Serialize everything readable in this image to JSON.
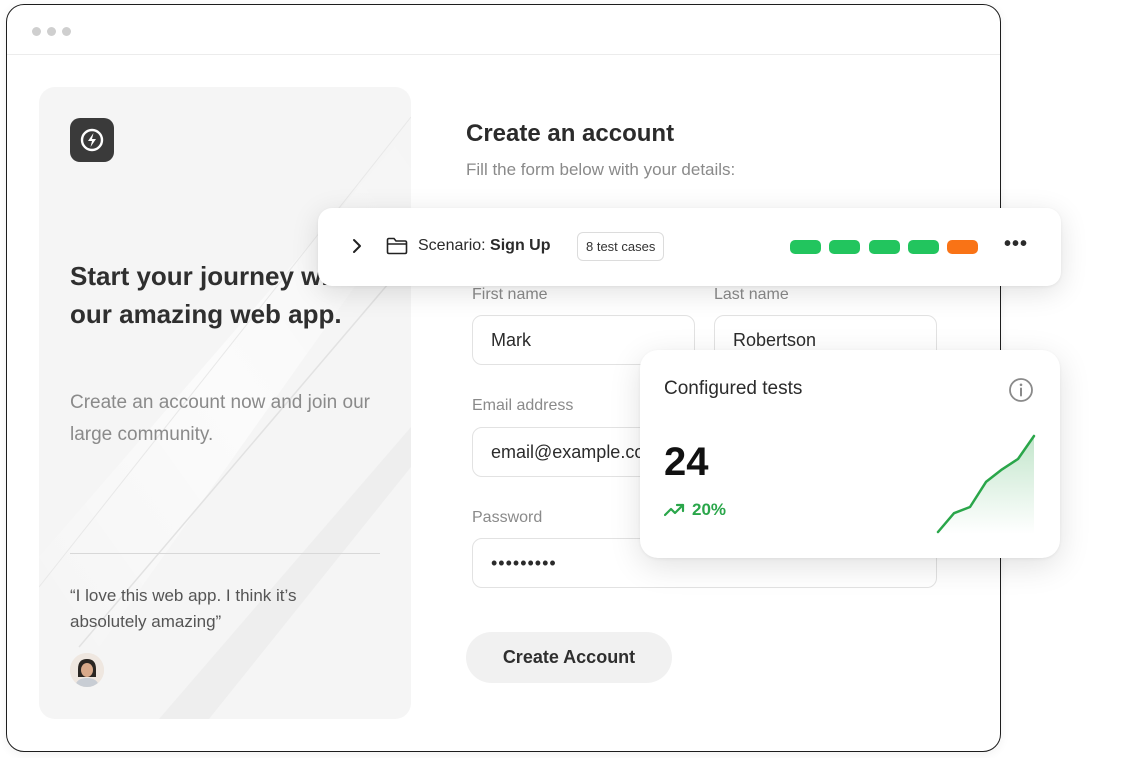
{
  "colors": {
    "status_green": "#22c55e",
    "status_orange": "#f97316",
    "trend_green": "#2aa64a"
  },
  "left_panel": {
    "logo_icon": "bolt-icon",
    "title": "Start your journey with our amazing web app.",
    "subtitle": "Create an account now and join our large community.",
    "quote": "“I love this web app. I think it’s absolutely amazing”",
    "avatar": "user-avatar"
  },
  "form": {
    "title": "Create an account",
    "subtitle": "Fill the form below with your details:",
    "first_name_label": "First name",
    "first_name_value": "Mark",
    "last_name_label": "Last name",
    "last_name_value": "Robertson",
    "email_label": "Email address",
    "email_value": "email@example.com",
    "password_label": "Password",
    "password_value": "•••••••••",
    "submit_label": "Create Account"
  },
  "scenario": {
    "prefix": "Scenario: ",
    "name": "Sign Up",
    "badge": "8 test cases",
    "statuses": [
      "pass",
      "pass",
      "pass",
      "pass",
      "fail"
    ],
    "more_label": "•••"
  },
  "tests_card": {
    "title": "Configured tests",
    "value": "24",
    "trend": "20%",
    "sparkline": [
      0,
      18,
      24,
      48,
      60,
      70,
      92
    ]
  }
}
